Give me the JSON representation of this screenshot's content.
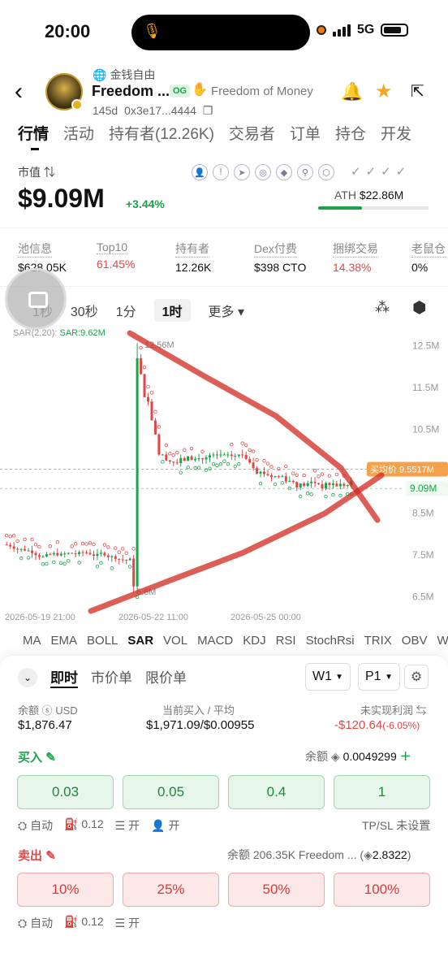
{
  "status_bar": {
    "time": "20:00",
    "network": "5G"
  },
  "header": {
    "sub_title": "金钱自由",
    "name": "Freedom ...",
    "badge": "OG",
    "full_name": "Freedom of Money",
    "age": "145d",
    "address": "0x3e17...4444"
  },
  "tabs": [
    "行情",
    "活动",
    "持有者(12.26K)",
    "交易者",
    "订单",
    "持仓",
    "开发"
  ],
  "market_cap": {
    "label": "市值 ⇅",
    "value": "$9.09M",
    "change": "+3.44%"
  },
  "ath": {
    "label": "ATH",
    "value": "$22.86M",
    "progress": 0.4
  },
  "stats": [
    {
      "label": "池信息",
      "value": "$628.05K",
      "color": "normal"
    },
    {
      "label": "Top10",
      "value": "61.45%",
      "color": "red"
    },
    {
      "label": "持有者",
      "value": "12.26K",
      "color": "normal"
    },
    {
      "label": "Dex付费",
      "value": "$398 CTO",
      "color": "normal"
    },
    {
      "label": "捆绑交易",
      "value": "14.38%",
      "color": "red"
    },
    {
      "label": "老鼠仓",
      "value": "0%",
      "color": "normal"
    }
  ],
  "intervals": {
    "items": [
      "1秒",
      "30秒",
      "1分",
      "1时"
    ],
    "selected": "1时",
    "more": "更多 ▾"
  },
  "chart_data": {
    "type": "candlestick",
    "indicator_label": "SAR(2,20):",
    "indicator_value": "SAR:9.62M",
    "y_ticks": [
      "12.5M",
      "11.5M",
      "10.5M",
      "8.5M",
      "7.5M",
      "6.5M"
    ],
    "x_ticks": [
      "2026-05-19 21:00",
      "2026-05-22 11:00",
      "2026-05-25 00:00"
    ],
    "high_label": "12.56M",
    "low_label": "6.6M",
    "buy_price_label": "买均价 9.5517M",
    "current_price_label": "9.09M",
    "ylim": [
      6.3,
      12.8
    ]
  },
  "indicators": {
    "items": [
      "MA",
      "EMA",
      "BOLL",
      "SAR",
      "VOL",
      "MACD",
      "KDJ",
      "RSI",
      "StochRsi",
      "TRIX",
      "OBV",
      "WR"
    ],
    "active": "SAR"
  },
  "order_panel": {
    "order_tabs": [
      "即时",
      "市价单",
      "限价单"
    ],
    "wallet": "W1",
    "preset": "P1",
    "balance_label": "余额 ⓢ USD",
    "balance_value": "$1,876.47",
    "buy_label": "当前买入 / 平均",
    "buy_value": "$1,971.09/$0.00955",
    "pnl_label": "未实现利润 ⇆",
    "pnl_value": "-$120.64",
    "pnl_pct": "(-6.05%)",
    "buy_section": "买入",
    "buy_balance_label": "余额",
    "buy_balance_value": "0.0049299",
    "buy_amounts": [
      "0.03",
      "0.05",
      "0.4",
      "1"
    ],
    "buy_auto": "自动",
    "buy_gas": "0.12",
    "buy_mev": "开",
    "buy_anti": "开",
    "tpsl": "TP/SL 未设置",
    "sell_section": "卖出",
    "sell_balance": "余额 206.35K Freedom ...",
    "sell_bnb": "2.8322",
    "sell_percents": [
      "10%",
      "25%",
      "50%",
      "100%"
    ],
    "sell_auto": "自动",
    "sell_gas": "0.12",
    "sell_mev": "开"
  }
}
